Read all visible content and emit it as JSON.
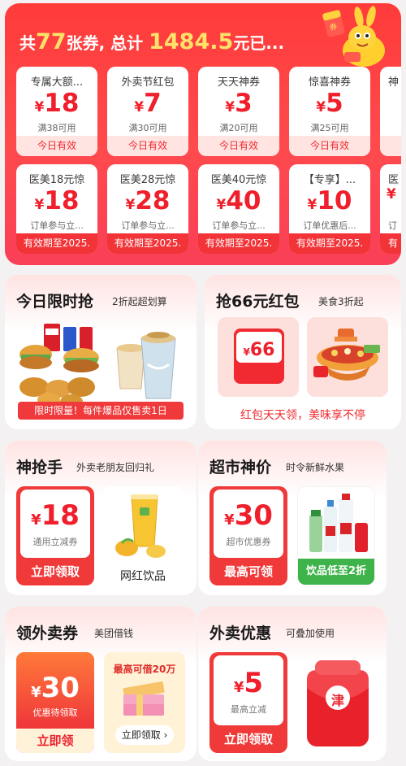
{
  "banner": {
    "title_prefix": "共",
    "coupon_count": "77",
    "title_mid": "张券, 总计",
    "total_amount": "1484.5",
    "title_suffix": "元已...",
    "row1": [
      {
        "title": "专属大额...",
        "currency": "¥",
        "amount": "18",
        "condition": "满38可用",
        "footer": "今日有效"
      },
      {
        "title": "外卖节红包",
        "currency": "¥",
        "amount": "7",
        "condition": "满30可用",
        "footer": "今日有效"
      },
      {
        "title": "天天神券",
        "currency": "¥",
        "amount": "3",
        "condition": "满20可用",
        "footer": "今日有效"
      },
      {
        "title": "惊喜神券",
        "currency": "¥",
        "amount": "5",
        "condition": "满25可用",
        "footer": "今日有效"
      },
      {
        "title": "神",
        "currency": "",
        "amount": "",
        "condition": "",
        "footer": ""
      }
    ],
    "row2": [
      {
        "title": "医美18元惊",
        "currency": "¥",
        "amount": "18",
        "condition": "订单参与立...",
        "footer": "有效期至2025."
      },
      {
        "title": "医美28元惊",
        "currency": "¥",
        "amount": "28",
        "condition": "订单参与立...",
        "footer": "有效期至2025."
      },
      {
        "title": "医美40元惊",
        "currency": "¥",
        "amount": "40",
        "condition": "订单参与立...",
        "footer": "有效期至2025."
      },
      {
        "title": "【专享】...",
        "currency": "¥",
        "amount": "10",
        "condition": "订单优惠后...",
        "footer": "有效期至2025."
      },
      {
        "title": "医",
        "currency": "¥",
        "amount": "",
        "condition": "订",
        "footer": "有"
      }
    ]
  },
  "flash_sale": {
    "title": "今日限时抢",
    "subtitle": "2折起超划算",
    "banner": "限时限量！每件爆品仅售卖1日"
  },
  "red_packet": {
    "title": "抢66元红包",
    "subtitle": "美食3折起",
    "packet_currency": "¥",
    "packet_amount": "66",
    "tagline": "红包天天领，美味享不停"
  },
  "grabber": {
    "title": "神抢手",
    "subtitle": "外卖老朋友回归礼",
    "currency": "¥",
    "amount": "18",
    "label": "通用立减券",
    "button": "立即领取",
    "product_label": "网红饮品"
  },
  "supermarket": {
    "title": "超市神价",
    "subtitle": "时令新鲜水果",
    "currency": "¥",
    "amount": "30",
    "label": "超市优惠券",
    "button": "最高可领",
    "product_label": "饮品低至2折"
  },
  "delivery_coupon": {
    "title": "领外卖券",
    "subtitle": "美团借钱",
    "currency": "¥",
    "amount": "30",
    "label": "优惠待领取",
    "button": "立即领",
    "loan_title": "最高可借20万",
    "loan_button": "立即领取 ›"
  },
  "delivery_discount": {
    "title": "外卖优惠",
    "subtitle": "可叠加使用",
    "currency": "¥",
    "amount": "5",
    "label": "最高立减",
    "button": "立即领取",
    "packet_char": "津"
  },
  "colors": {
    "brand_red": "#f03a3a",
    "banner_red": "#ff3b3a",
    "yellow": "#ffe26a",
    "green": "#3db349"
  }
}
